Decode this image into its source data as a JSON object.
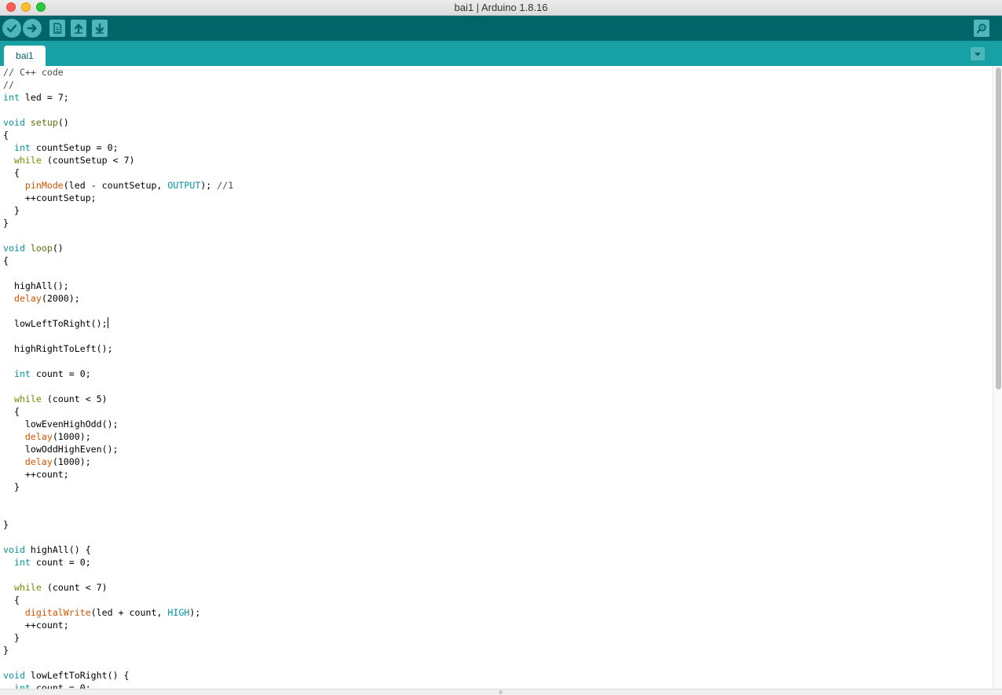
{
  "window": {
    "title": "bai1 | Arduino 1.8.16"
  },
  "toolbar": {
    "buttons": [
      {
        "name": "verify",
        "icon": "checkmark-icon"
      },
      {
        "name": "upload",
        "icon": "arrow-right-icon"
      },
      {
        "name": "new",
        "icon": "document-icon"
      },
      {
        "name": "open",
        "icon": "arrow-up-icon"
      },
      {
        "name": "save",
        "icon": "arrow-down-icon"
      },
      {
        "name": "serial-monitor",
        "icon": "magnifier-icon"
      }
    ]
  },
  "tabs": [
    {
      "label": "bai1",
      "active": true
    }
  ],
  "colors": {
    "toolbar_bg": "#006468",
    "tabstrip_bg": "#17a1a5",
    "button_bg": "#4db7bb",
    "keyword": "#00979c",
    "function": "#d35400"
  },
  "editor": {
    "lines": [
      [
        [
          "cm",
          "// C++ code"
        ]
      ],
      [
        [
          "cm",
          "//"
        ]
      ],
      [
        [
          "kw",
          "int"
        ],
        [
          "t",
          " led = 7;"
        ]
      ],
      [],
      [
        [
          "kw",
          "void"
        ],
        [
          "t",
          " "
        ],
        [
          "fn2",
          "setup"
        ],
        [
          "t",
          "()"
        ]
      ],
      [
        [
          "t",
          "{"
        ]
      ],
      [
        [
          "t",
          "  "
        ],
        [
          "kw",
          "int"
        ],
        [
          "t",
          " countSetup = 0;"
        ]
      ],
      [
        [
          "t",
          "  "
        ],
        [
          "kw2",
          "while"
        ],
        [
          "t",
          " (countSetup < 7)"
        ]
      ],
      [
        [
          "t",
          "  {"
        ]
      ],
      [
        [
          "t",
          "    "
        ],
        [
          "fn",
          "pinMode"
        ],
        [
          "t",
          "(led - countSetup, "
        ],
        [
          "ct",
          "OUTPUT"
        ],
        [
          "t",
          "); "
        ],
        [
          "cm",
          "//1"
        ]
      ],
      [
        [
          "t",
          "    ++countSetup;"
        ]
      ],
      [
        [
          "t",
          "  }"
        ]
      ],
      [
        [
          "t",
          "}"
        ]
      ],
      [],
      [
        [
          "kw",
          "void"
        ],
        [
          "t",
          " "
        ],
        [
          "fn2",
          "loop"
        ],
        [
          "t",
          "()"
        ]
      ],
      [
        [
          "t",
          "{"
        ]
      ],
      [],
      [
        [
          "t",
          "  highAll();"
        ]
      ],
      [
        [
          "t",
          "  "
        ],
        [
          "fn",
          "delay"
        ],
        [
          "t",
          "(2000);"
        ]
      ],
      [],
      [
        [
          "t",
          "  lowLeftToRight();"
        ],
        [
          "caret",
          ""
        ]
      ],
      [],
      [
        [
          "t",
          "  highRightToLeft();"
        ]
      ],
      [],
      [
        [
          "t",
          "  "
        ],
        [
          "kw",
          "int"
        ],
        [
          "t",
          " count = 0;"
        ]
      ],
      [],
      [
        [
          "t",
          "  "
        ],
        [
          "kw2",
          "while"
        ],
        [
          "t",
          " (count < 5)"
        ]
      ],
      [
        [
          "t",
          "  {"
        ]
      ],
      [
        [
          "t",
          "    lowEvenHighOdd();"
        ]
      ],
      [
        [
          "t",
          "    "
        ],
        [
          "fn",
          "delay"
        ],
        [
          "t",
          "(1000);"
        ]
      ],
      [
        [
          "t",
          "    lowOddHighEven();"
        ]
      ],
      [
        [
          "t",
          "    "
        ],
        [
          "fn",
          "delay"
        ],
        [
          "t",
          "(1000);"
        ]
      ],
      [
        [
          "t",
          "    ++count;"
        ]
      ],
      [
        [
          "t",
          "  }"
        ]
      ],
      [],
      [],
      [
        [
          "t",
          "}"
        ]
      ],
      [],
      [
        [
          "kw",
          "void"
        ],
        [
          "t",
          " highAll() {"
        ]
      ],
      [
        [
          "t",
          "  "
        ],
        [
          "kw",
          "int"
        ],
        [
          "t",
          " count = 0;"
        ]
      ],
      [],
      [
        [
          "t",
          "  "
        ],
        [
          "kw2",
          "while"
        ],
        [
          "t",
          " (count < 7)"
        ]
      ],
      [
        [
          "t",
          "  {"
        ]
      ],
      [
        [
          "t",
          "    "
        ],
        [
          "fn",
          "digitalWrite"
        ],
        [
          "t",
          "(led + count, "
        ],
        [
          "ct",
          "HIGH"
        ],
        [
          "t",
          ");"
        ]
      ],
      [
        [
          "t",
          "    ++count;"
        ]
      ],
      [
        [
          "t",
          "  }"
        ]
      ],
      [
        [
          "t",
          "}"
        ]
      ],
      [],
      [
        [
          "kw",
          "void"
        ],
        [
          "t",
          " lowLeftToRight() {"
        ]
      ],
      [
        [
          "t",
          "  "
        ],
        [
          "kw",
          "int"
        ],
        [
          "t",
          " count = 0;"
        ]
      ]
    ]
  }
}
